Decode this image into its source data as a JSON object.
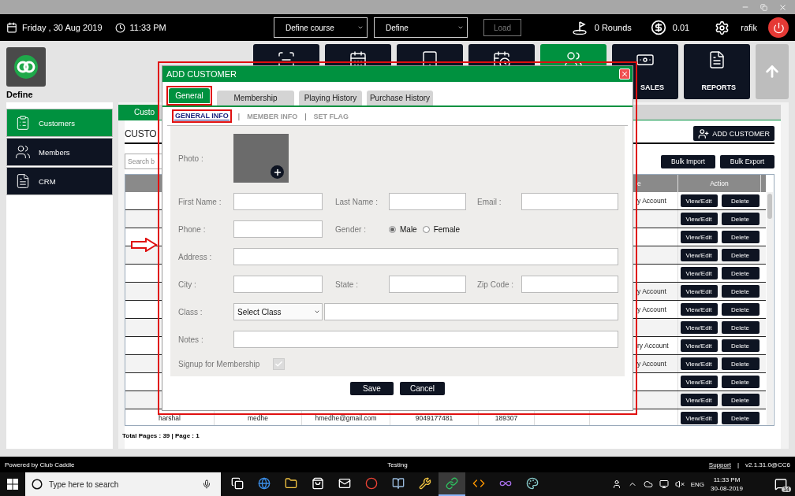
{
  "top_bar": {
    "date": "Friday ,  30 Aug 2019",
    "time": "11:33 PM",
    "course_select": "Define course",
    "define_select": "Define",
    "load_button": {
      "label": "Load",
      "disabled": true
    },
    "rounds": "0 Rounds",
    "balance": "0.01",
    "user": "rafik"
  },
  "brand": {
    "label": "Define"
  },
  "modules": [
    {
      "kind": "scanner",
      "selected": false
    },
    {
      "kind": "calendar",
      "selected": false
    },
    {
      "kind": "tablet",
      "selected": false
    },
    {
      "kind": "schedule",
      "selected": false
    },
    {
      "kind": "customers",
      "selected": true
    },
    {
      "kind": "sales",
      "label": "SALES",
      "selected": false
    },
    {
      "kind": "reports",
      "label": "REPORTS",
      "selected": false
    }
  ],
  "sidebar": {
    "items": [
      {
        "kind": "customers",
        "label": "Customers",
        "selected": true
      },
      {
        "kind": "members",
        "label": "Members",
        "selected": false
      },
      {
        "kind": "crm",
        "label": "CRM",
        "selected": false
      }
    ]
  },
  "main": {
    "tab": "Custo",
    "heading": "CUSTO",
    "add_button": "ADD CUSTOMER",
    "search_placeholder": "Search b",
    "bulk_buttons": [
      "Bulk Import",
      "Bulk Export"
    ],
    "table": {
      "columns": [
        "e",
        "Action"
      ],
      "rows": [
        {
          "type": "y Account",
          "actions": [
            "View/Edit",
            "Delete"
          ]
        },
        {
          "actions": [
            "View/Edit",
            "Delete"
          ]
        },
        {
          "actions": [
            "View/Edit",
            "Delete"
          ]
        },
        {
          "actions": [
            "View/Edit",
            "Delete"
          ]
        },
        {
          "actions": [
            "View/Edit",
            "Delete"
          ]
        },
        {
          "type": "y Account",
          "actions": [
            "View/Edit",
            "Delete"
          ]
        },
        {
          "type": "y Account",
          "actions": [
            "View/Edit",
            "Delete"
          ]
        },
        {
          "actions": [
            "View/Edit",
            "Delete"
          ]
        },
        {
          "type": "ry Account",
          "actions": [
            "View/Edit",
            "Delete"
          ]
        },
        {
          "type": "y Account",
          "actions": [
            "View/Edit",
            "Delete"
          ]
        },
        {
          "actions": [
            "View/Edit",
            "Delete"
          ]
        },
        {
          "actions": [
            "View/Edit",
            "Delete"
          ]
        },
        {
          "cells": [
            "harshal",
            "medhe",
            "hmedhe@gmail.com",
            "9049177481",
            "189307"
          ],
          "actions": [
            "View/Edit",
            "Delete"
          ]
        }
      ]
    },
    "total": "Total Pages : 39 | Page : 1"
  },
  "dialog": {
    "title": "ADD CUSTOMER",
    "tabs": [
      {
        "label": "General",
        "selected": true
      },
      {
        "label": "Membership",
        "selected": false
      },
      {
        "label": "Playing History",
        "selected": false
      },
      {
        "label": "Purchase History",
        "selected": false
      }
    ],
    "subtabs": [
      {
        "label": "GENERAL INFO",
        "selected": true
      },
      {
        "separator": "|",
        "label": "MEMBER INFO",
        "selected": false
      },
      {
        "separator": "|",
        "label": "SET FLAG",
        "selected": false
      }
    ],
    "form": {
      "photo": "Photo :",
      "first_name": "First Name :",
      "last_name": "Last Name :",
      "email": "Email :",
      "phone": "Phone :",
      "gender": "Gender :",
      "genders": [
        {
          "label": "Male",
          "selected": true
        },
        {
          "label": "Female",
          "selected": false
        }
      ],
      "address": "Address :",
      "city": "City :",
      "state": "State :",
      "zip": "Zip Code :",
      "class": "Class :",
      "class_select": "Select Class",
      "notes": "Notes :",
      "signup": {
        "label": "Signup for Membership",
        "checked": true,
        "disabled": true
      }
    },
    "buttons": [
      "Save",
      "Cancel"
    ]
  },
  "footer": {
    "powered": "Powered by Club Caddie",
    "env": "Testing",
    "support": "Support",
    "separator": "|",
    "version": "v2.1.31.0@CC6"
  },
  "taskbar": {
    "search_placeholder": "Type here to search",
    "apps": [
      {
        "kind": "taskview",
        "active": false
      },
      {
        "kind": "browser",
        "active": false
      },
      {
        "kind": "folder",
        "active": false
      },
      {
        "kind": "store",
        "active": false
      },
      {
        "kind": "mail",
        "active": false
      },
      {
        "kind": "chrome",
        "active": false
      },
      {
        "kind": "notes",
        "active": false
      },
      {
        "kind": "tools",
        "active": false
      },
      {
        "kind": "caddie",
        "active": true
      },
      {
        "kind": "editor",
        "active": false
      },
      {
        "kind": "studio",
        "active": false
      },
      {
        "kind": "paint",
        "active": false
      }
    ],
    "language": "ENG",
    "time": "11:33 PM",
    "date": "30-08-2019",
    "notifications": "14"
  }
}
